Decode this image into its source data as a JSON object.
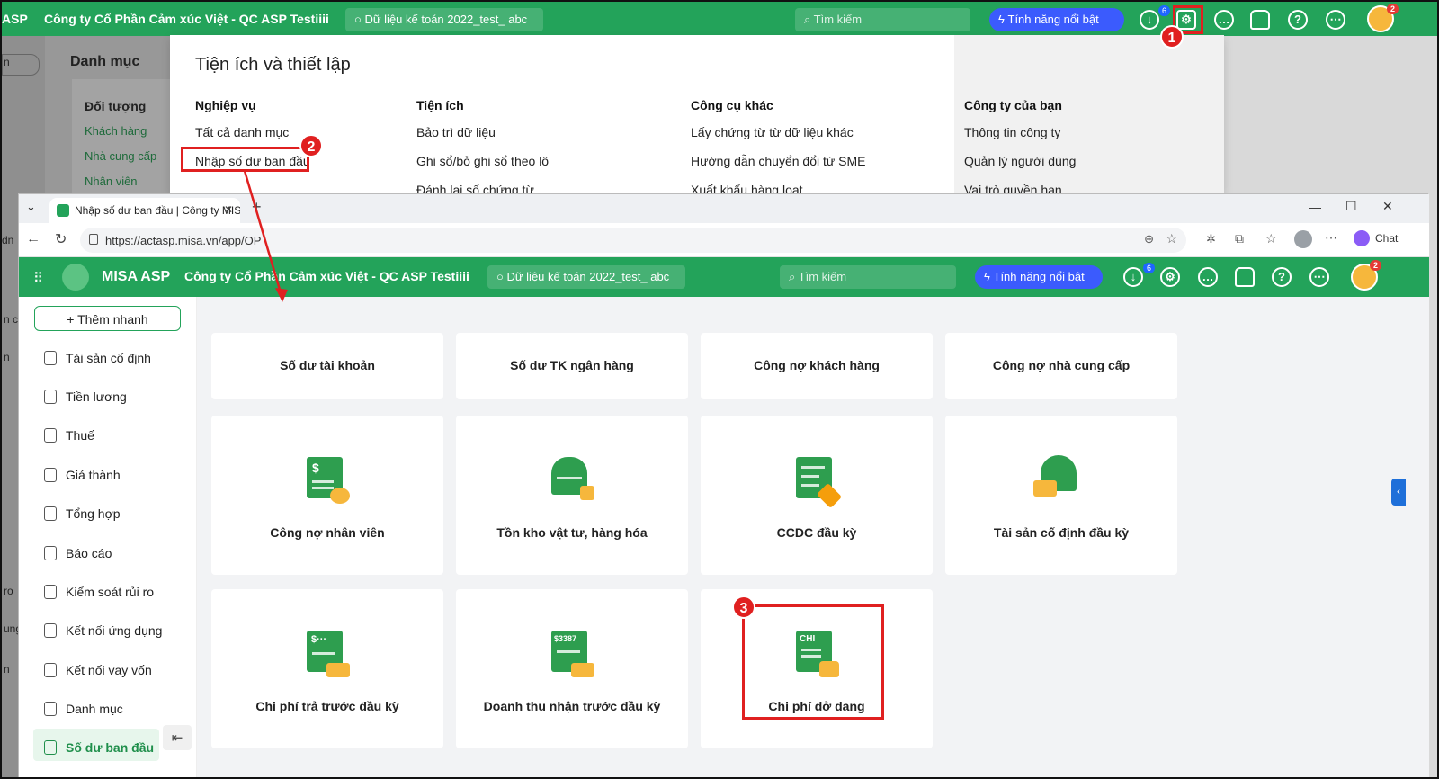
{
  "bg_app": {
    "logo": "ASP",
    "company": "Công ty Cổ Phần Cảm xúc Việt - QC ASP Testiiii",
    "db": "Dữ liệu kế toán 2022_test_ abc",
    "search_placeholder": "Tìm kiếm",
    "features": "Tính năng nổi bật",
    "download_badge": "6",
    "avatar_badge": "2",
    "page_title": "Danh mục",
    "group": "Đối tượng",
    "items": [
      "Khách hàng",
      "Nhà cung cấp",
      "Nhân viên"
    ],
    "left_cut": [
      "n",
      "dn",
      "n ci",
      "n",
      "ro",
      "ung",
      "n"
    ]
  },
  "panel": {
    "title": "Tiện ích và thiết lập",
    "columns": [
      {
        "heading": "Nghiệp vụ",
        "items": [
          "Tất cả danh mục",
          "Nhập số dư ban đầu"
        ]
      },
      {
        "heading": "Tiện ích",
        "items": [
          "Bảo trì dữ liệu",
          "Ghi sổ/bỏ ghi sổ theo lô",
          "Đánh lại số chứng từ"
        ]
      },
      {
        "heading": "Công cụ khác",
        "items": [
          "Lấy chứng từ từ dữ liệu khác",
          "Hướng dẫn chuyển đổi từ SME",
          "Xuất khẩu hàng loạt"
        ]
      },
      {
        "heading": "Công ty của bạn",
        "items": [
          "Thông tin công ty",
          "Quản lý người dùng",
          "Vai trò quyền hạn"
        ]
      }
    ]
  },
  "annotations": [
    "1",
    "2",
    "3"
  ],
  "browser": {
    "tab_title": "Nhập số dư ban đầu | Công ty MIS",
    "url": "https://actasp.misa.vn/app/OP",
    "chat": "Chat",
    "window_minimize": "—",
    "window_maximize": "☐",
    "window_close": "✕"
  },
  "app": {
    "brand": "MISA ASP",
    "company": "Công ty Cổ Phần Cảm xúc Việt - QC ASP Testiiii",
    "db": "Dữ liệu kế toán 2022_test_ abc",
    "search_placeholder": "Tìm kiếm",
    "features": "Tính năng nổi bật",
    "download_badge": "6",
    "avatar_badge": "2",
    "quick_add": "+ Thêm nhanh"
  },
  "sidebar": [
    "Tài sản cố định",
    "Tiền lương",
    "Thuế",
    "Giá thành",
    "Tổng hợp",
    "Báo cáo",
    "Kiểm soát rủi ro",
    "Kết nối ứng dụng",
    "Kết nối vay vốn",
    "Danh mục",
    "Số dư ban đầu"
  ],
  "cards": [
    "Số dư tài khoản",
    "Số dư TK ngân hàng",
    "Công nợ khách hàng",
    "Công nợ nhà cung cấp",
    "Công nợ nhân viên",
    "Tồn kho vật tư, hàng hóa",
    "CCDC đầu kỳ",
    "Tài sản cố định đầu kỳ",
    "Chi phí trả trước đầu kỳ",
    "Doanh thu nhận trước đầu kỳ",
    "Chi phí dở dang"
  ],
  "icon_labels": [
    "$",
    "$3387",
    "CHI"
  ]
}
